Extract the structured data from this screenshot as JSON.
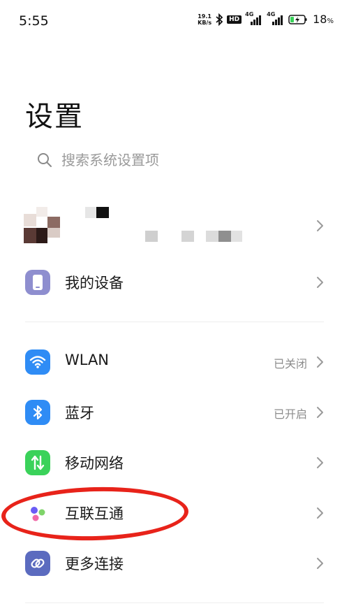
{
  "status_bar": {
    "time": "5:55",
    "speed_value": "19.1",
    "speed_unit": "KB/s",
    "hd_badge": "HD",
    "net1": "4G",
    "net2": "4G",
    "battery_percent": "18",
    "battery_unit": "%",
    "icons": [
      "bluetooth-icon",
      "signal-icon",
      "signal-icon",
      "battery-charging-icon"
    ]
  },
  "page": {
    "title": "设置"
  },
  "search": {
    "placeholder": "搜索系统设置项"
  },
  "sections": [
    {
      "items": [
        {
          "label": "我的设备",
          "icon": "device-icon",
          "icon_color": "#8e8ecf"
        }
      ]
    },
    {
      "items": [
        {
          "label": "WLAN",
          "value": "已关闭",
          "icon": "wifi-icon",
          "icon_color": "#2f8cf5"
        },
        {
          "label": "蓝牙",
          "value": "已开启",
          "icon": "bluetooth-icon",
          "icon_color": "#2f8cf5"
        },
        {
          "label": "移动网络",
          "icon": "mobile-data-icon",
          "icon_color": "#3ad25a"
        },
        {
          "label": "互联互通",
          "icon": "interconnect-icon",
          "icon_color": "#ffffff"
        },
        {
          "label": "更多连接",
          "icon": "link-icon",
          "icon_color": "#5b6bbf"
        }
      ]
    }
  ],
  "colors": {
    "highlight_ring": "#e8231a",
    "secondary_text": "#8c8c8c"
  }
}
